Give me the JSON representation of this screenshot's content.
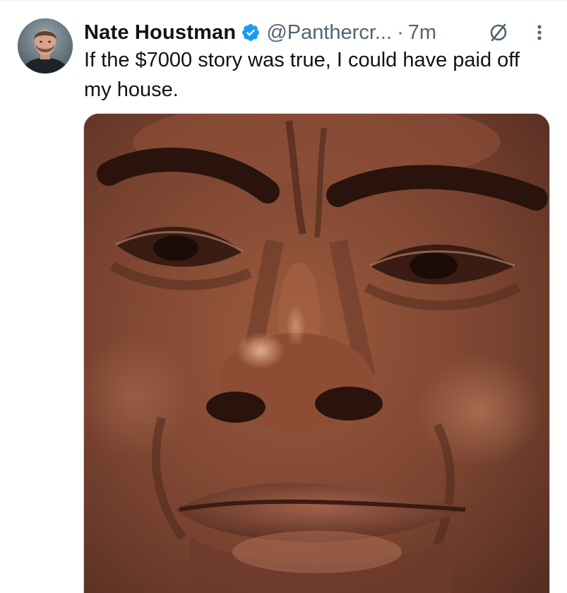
{
  "tweet": {
    "author": {
      "display_name": "Nate Houstman",
      "handle": "@Panthercr...",
      "verified": true,
      "verified_icon": "verified-badge-icon",
      "avatar_icon": "avatar"
    },
    "separator": "·",
    "timestamp": "7m",
    "text": "If the $7000 story was true, I could have paid off my house.",
    "header_actions": {
      "grok_icon": "grok-icon",
      "more_icon": "more-vertical-icon"
    },
    "media": {
      "type": "image",
      "description_icon": "photo"
    }
  },
  "colors": {
    "name": "#0f1419",
    "meta": "#536471",
    "verified": "#1d9bf0",
    "background": "#ffffff",
    "border": "#cfd9de"
  }
}
